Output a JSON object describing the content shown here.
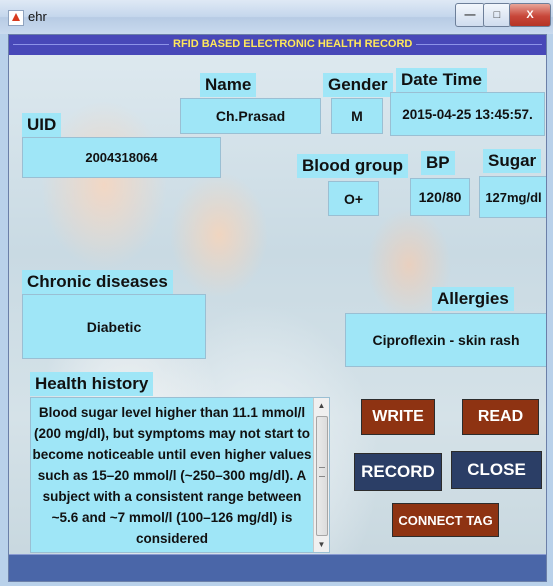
{
  "window": {
    "title": "ehr"
  },
  "header": {
    "title": "RFID BASED ELECTRONIC HEALTH RECORD"
  },
  "fields": {
    "uid": {
      "label": "UID",
      "value": "2004318064"
    },
    "name": {
      "label": "Name",
      "value": "Ch.Prasad"
    },
    "gender": {
      "label": "Gender",
      "value": "M"
    },
    "datetime": {
      "label": "Date Time",
      "value": "2015-04-25 13:45:57."
    },
    "blood_group": {
      "label": "Blood group",
      "value": "O+"
    },
    "bp": {
      "label": "BP",
      "value": "120/80"
    },
    "sugar": {
      "label": "Sugar",
      "value": "127mg/dl"
    },
    "chronic": {
      "label": "Chronic diseases",
      "value": "Diabetic"
    },
    "allergies": {
      "label": "Allergies",
      "value": "Ciproflexin - skin rash"
    },
    "history": {
      "label": "Health history",
      "value": "Blood sugar level higher than 11.1 mmol/l (200 mg/dl), but symptoms may not start to become noticeable until even higher values such as 15–20 mmol/l (~250–300 mg/dl). A subject with a consistent range between ~5.6 and ~7 mmol/l (100–126 mg/dl) is considered"
    }
  },
  "buttons": {
    "write": "WRITE",
    "read": "READ",
    "record": "RECORD",
    "close": "CLOSE",
    "connect": "CONNECT TAG"
  },
  "colors": {
    "field_bg": "#9fe6f7",
    "header_bar": "#4848b8",
    "header_text": "#ffe85a",
    "button_brown": "#8e3312",
    "button_navy": "#2b3e66"
  }
}
